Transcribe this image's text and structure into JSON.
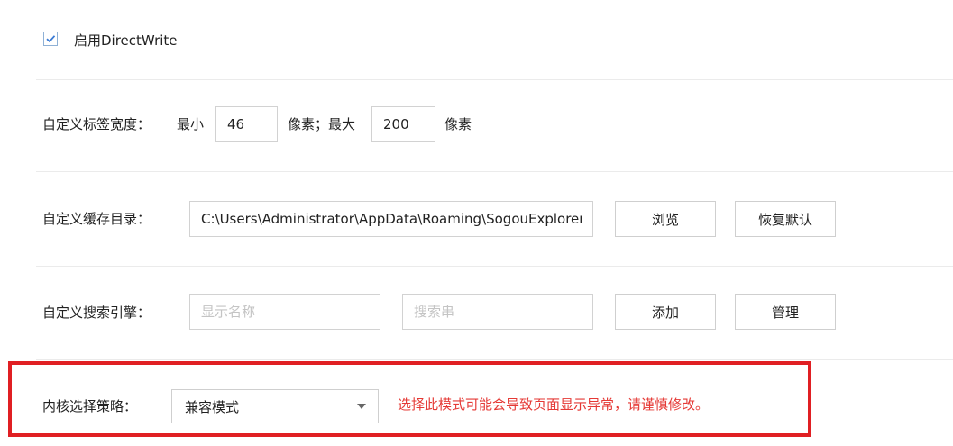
{
  "directwrite": {
    "checked": true,
    "label": "启用DirectWrite"
  },
  "tab_width": {
    "label": "自定义标签宽度：",
    "min_label": "最小",
    "min_value": "46",
    "mid_label": "像素；最大",
    "max_value": "200",
    "unit_label": "像素"
  },
  "cache_dir": {
    "label": "自定义缓存目录：",
    "path": "C:\\Users\\Administrator\\AppData\\Roaming\\SogouExplorer",
    "browse_label": "浏览",
    "reset_label": "恢复默认"
  },
  "search_engine": {
    "label": "自定义搜索引擎：",
    "name_placeholder": "显示名称",
    "query_placeholder": "搜索串",
    "add_label": "添加",
    "manage_label": "管理"
  },
  "kernel": {
    "label": "内核选择策略：",
    "selected": "兼容模式",
    "warning": "选择此模式可能会导致页面显示异常，请谨慎修改。"
  },
  "colors": {
    "highlight": "#e01f23",
    "warning_text": "#e53935",
    "check_accent": "#3a7bd5"
  },
  "icons": {
    "checkbox_mark": "checkmark-icon",
    "dropdown": "chevron-down-icon"
  }
}
